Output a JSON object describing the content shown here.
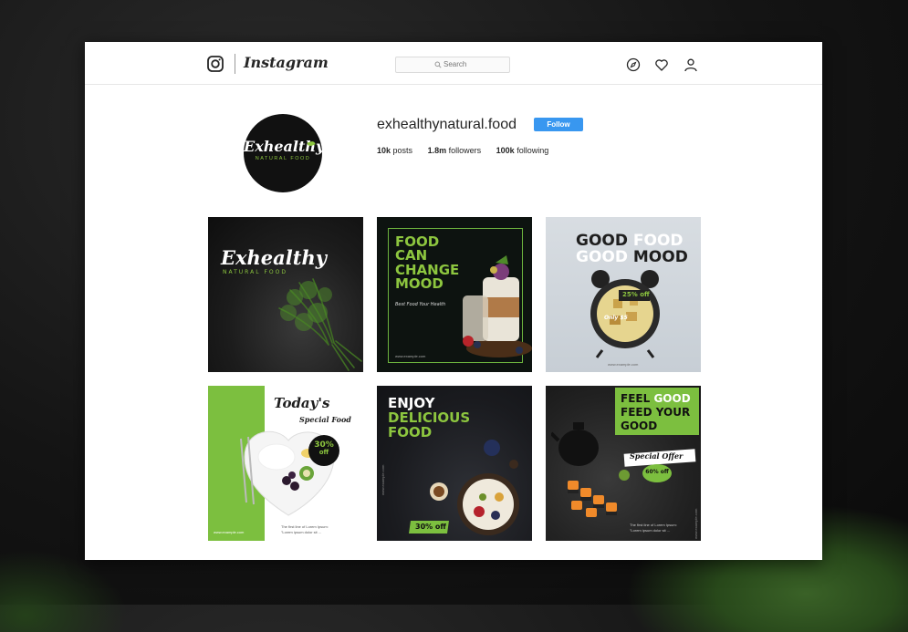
{
  "app": {
    "name": "Instagram"
  },
  "search": {
    "placeholder": "Search"
  },
  "icons": {
    "logo": "instagram-camera-icon",
    "search": "search-icon",
    "explore": "compass-icon",
    "activity": "heart-icon",
    "profile": "user-icon"
  },
  "colors": {
    "accent": "#3897f0",
    "brand_green": "#8dc63f"
  },
  "profile": {
    "username": "exhealthynatural.food",
    "avatar_brand": "Exhealthy",
    "avatar_sub": "NATURAL FOOD",
    "follow_label": "Follow",
    "stats": [
      {
        "value": "10k",
        "label": "posts"
      },
      {
        "value": "1.8m",
        "label": "followers"
      },
      {
        "value": "100k",
        "label": "following"
      }
    ]
  },
  "posts": [
    {
      "brand": "Exhealthy",
      "sub": "NATURAL FOOD"
    },
    {
      "title_lines": [
        "FOOD",
        "CAN",
        "CHANGE",
        "MOOD"
      ],
      "tagline": "Best Food Your Health",
      "url": "www.example.com"
    },
    {
      "title_line1_a": "GOOD",
      "title_line1_b": "FOOD",
      "title_line2_a": "GOOD",
      "title_line2_b": "MOOD",
      "badge": "25% off",
      "price": "Only $5",
      "url": "www.example.com"
    },
    {
      "title": "Today's",
      "subtitle": "Special Food",
      "badge_pct": "30%",
      "badge_off": "off",
      "url": "www.example.com",
      "desc_line1": "The first line of Lorem Ipsum:",
      "desc_line2": "\"Lorem ipsum dolor sit ..."
    },
    {
      "title_line1": "ENJOY",
      "title_line2": "DELICIOUS",
      "title_line3": "FOOD",
      "badge": "30% off",
      "url": "www.example.com"
    },
    {
      "title_line1_a": "FEEL",
      "title_line1_b": "GOOD",
      "title_line2": "FEED YOUR",
      "title_line3": "GOOD",
      "offer": "Special Offer",
      "badge_pct": "60%",
      "badge_off": "off",
      "desc_line1": "The first line of Lorem Ipsum:",
      "desc_line2": "\"Lorem ipsum dolor sit ...",
      "url": "www.example.com"
    }
  ]
}
